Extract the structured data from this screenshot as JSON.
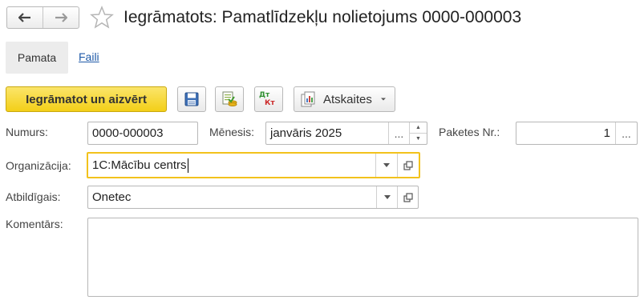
{
  "window": {
    "title": "Iegrāmatots: Pamatlīdzekļu nolietojums 0000-000003",
    "icons": [
      "back-arrow-icon",
      "forward-arrow-icon",
      "favorite-star-icon"
    ]
  },
  "tabs": [
    {
      "label": "Pamata",
      "active": true
    },
    {
      "label": "Faili",
      "active": false
    }
  ],
  "toolbar": {
    "post_and_close_label": "Iegrāmatot un aizvērt",
    "save_icon": "floppy-disk-icon",
    "post_icon": "post-document-icon",
    "dt_kt_icon": {
      "top": "Дт",
      "bottom": "Кт"
    },
    "reports_label": "Atskaites",
    "reports_icon": "reports-icon"
  },
  "form": {
    "number": {
      "label": "Numurs:",
      "value": "0000-000003"
    },
    "month": {
      "label": "Mēnesis:",
      "value": "janvāris 2025",
      "select_button": "..."
    },
    "package": {
      "label": "Paketes Nr.:",
      "value": "1",
      "select_button": "..."
    },
    "organization": {
      "label": "Organizācija:",
      "value": "1C:Mācību centrs"
    },
    "responsible": {
      "label": "Atbildīgais:",
      "value": "Onetec"
    },
    "comment": {
      "label": "Komentārs:",
      "value": ""
    }
  },
  "colors": {
    "accent_yellow": "#f3cf18",
    "focus_border": "#f2c21c",
    "link_blue": "#1f5aa8"
  }
}
